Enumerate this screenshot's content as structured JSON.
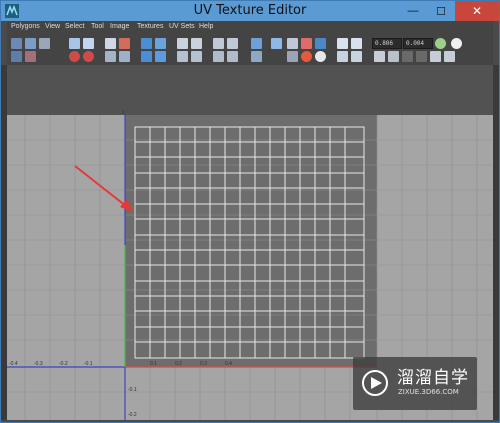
{
  "window": {
    "title": "UV Texture Editor",
    "minimize_glyph": "—",
    "maximize_glyph": "☐",
    "close_glyph": "✕"
  },
  "menu": {
    "items": [
      "Polygons",
      "View",
      "Select",
      "Tool",
      "Image",
      "Textures",
      "UV Sets",
      "Help"
    ]
  },
  "toolbar": {
    "u_value": "0.806",
    "v_value": "0.004"
  },
  "axis": {
    "neg_x_labels": [
      "-0.4",
      "-0.3",
      "-0.2",
      "-0.1"
    ],
    "pos_x_labels": [
      "0.1",
      "0.2",
      "0.3",
      "0.4"
    ],
    "neg_y_labels": [
      "-0.1",
      "-0.2"
    ],
    "top_label": "1"
  },
  "watermark": {
    "brand_cn": "溜溜自学",
    "url": "ZIXUE.3D66.COM"
  },
  "colors": {
    "accent": "#5b9bd5",
    "close": "#c9463d",
    "arrow": "#e53935"
  }
}
